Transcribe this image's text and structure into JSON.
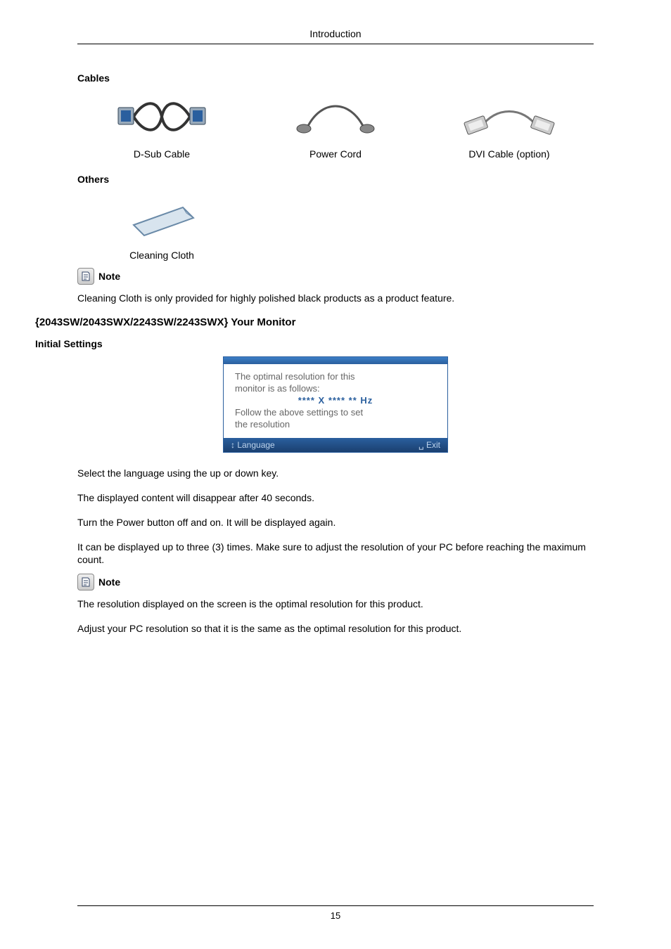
{
  "header": "Introduction",
  "cables": {
    "heading": "Cables",
    "items": [
      {
        "caption": "D-Sub Cable"
      },
      {
        "caption": "Power Cord"
      },
      {
        "caption": "DVI Cable (option)"
      }
    ]
  },
  "others": {
    "heading": "Others",
    "items": [
      {
        "caption": "Cleaning Cloth"
      }
    ]
  },
  "note1": {
    "label": "Note",
    "text": "Cleaning Cloth is only provided for highly polished black products as a product feature."
  },
  "model_heading": "{2043SW/2043SWX/2243SW/2243SWX} Your Monitor",
  "initial_heading": "Initial Settings",
  "osd": {
    "line1": "The optimal resolution for this",
    "line2": "monitor is as follows:",
    "line3": "**** X **** ** Hz",
    "line4": "Follow the above settings to set",
    "line5": "the resolution",
    "foot_left": "↕ Language",
    "foot_right": "␣ Exit"
  },
  "paras": {
    "p1": "Select the language using the up or down key.",
    "p2": "The displayed content will disappear after 40 seconds.",
    "p3": "Turn the Power button off and on. It will be displayed again.",
    "p4": "It can be displayed up to three (3) times. Make sure to adjust the resolution of your PC before reaching the maximum count."
  },
  "note2": {
    "label": "Note",
    "text1": "The resolution displayed on the screen is the optimal resolution for this product.",
    "text2": "Adjust your PC resolution so that it is the same as the optimal resolution for this product."
  },
  "page_number": "15"
}
